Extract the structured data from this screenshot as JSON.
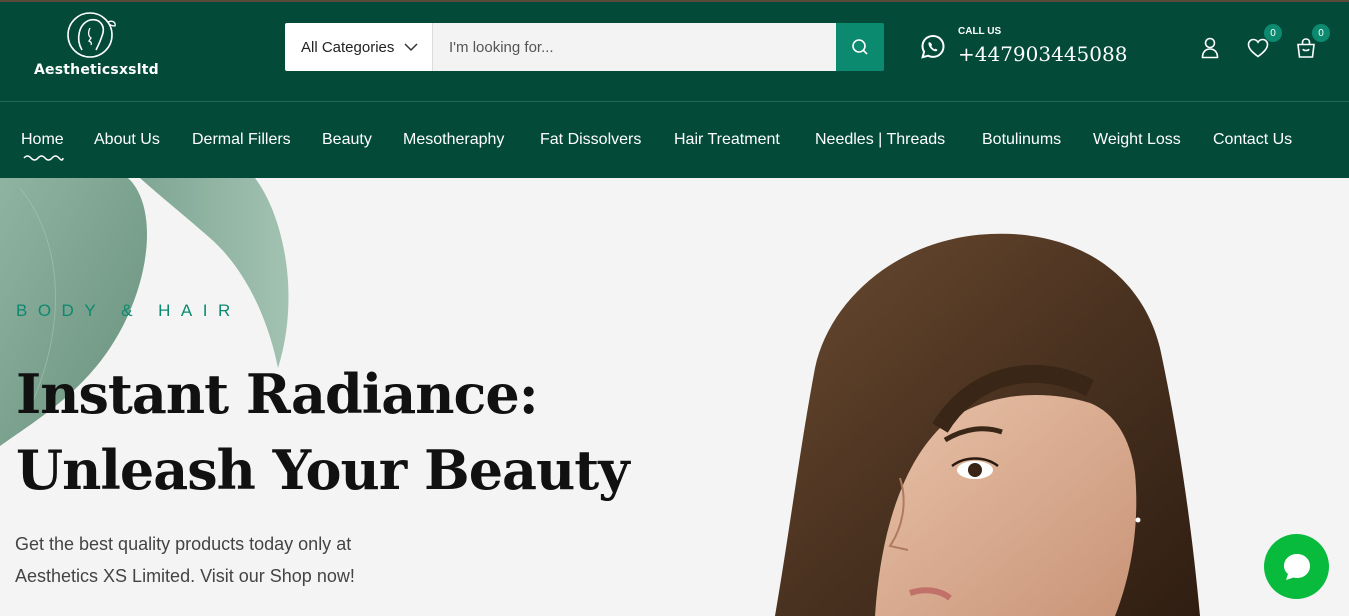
{
  "brand": {
    "name": "Aestheticsxsltd"
  },
  "search": {
    "category": "All Categories",
    "placeholder": "I'm looking for..."
  },
  "call": {
    "label": "CALL US",
    "number": "+447903445088"
  },
  "wishlist": {
    "count": "0"
  },
  "cart": {
    "count": "0"
  },
  "nav": {
    "items": [
      "Home",
      "About Us",
      "Dermal Fillers",
      "Beauty",
      "Mesotheraphy",
      "Fat Dissolvers",
      "Hair Treatment",
      "Needles | Threads",
      "Botulinums",
      "Weight Loss",
      "Contact Us"
    ],
    "active": "Home"
  },
  "hero": {
    "eyebrow": "BODY & HAIR",
    "title_line1": "Instant Radiance:",
    "title_line2": "Unleash Your Beauty",
    "subtitle_line1": "Get the best quality products today only at",
    "subtitle_line2": "Aesthetics XS Limited. Visit our Shop now!"
  },
  "colors": {
    "header_bg": "#034b38",
    "accent": "#0c8a70",
    "chat_bg": "#08bb3d",
    "hero_bg": "#f4f4f4"
  },
  "icons": {
    "search": "search-icon",
    "whatsapp": "whatsapp-icon",
    "account": "user-icon",
    "wishlist": "heart-icon",
    "cart": "bag-icon",
    "chat": "chat-icon"
  }
}
